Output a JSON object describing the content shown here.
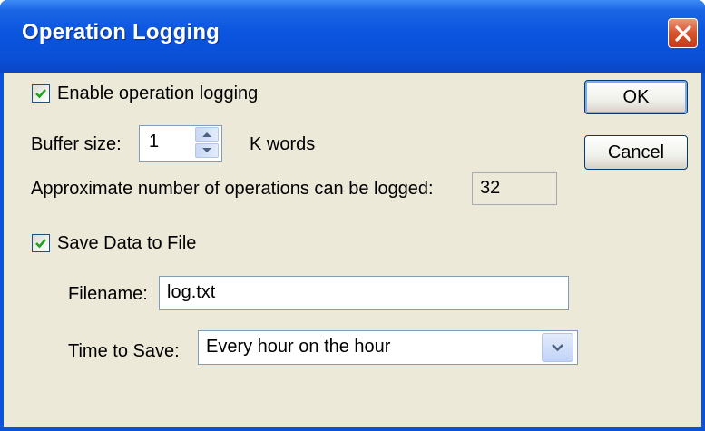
{
  "window": {
    "title": "Operation Logging"
  },
  "logging": {
    "enable_label": "Enable operation logging",
    "enable_checked": true,
    "buffer_label": "Buffer size:",
    "buffer_value": "1",
    "buffer_unit": "K words",
    "approx_label": "Approximate number of operations can be logged:",
    "approx_value": "32"
  },
  "save": {
    "checkbox_label": "Save Data to File",
    "checked": true,
    "filename_label": "Filename:",
    "filename_value": "log.txt",
    "time_label": "Time to Save:",
    "time_value": "Every hour on the hour"
  },
  "buttons": {
    "ok": "OK",
    "cancel": "Cancel"
  },
  "icons": {
    "close": "close-icon",
    "check": "checkmark-icon",
    "spin_up": "arrow-up-icon",
    "spin_down": "arrow-down-icon",
    "dropdown": "chevron-down-icon"
  },
  "colors": {
    "titlebar": "#0a53d8",
    "dialog_bg": "#ece9d8",
    "close_button": "#d6542c",
    "check_mark": "#21a121"
  }
}
